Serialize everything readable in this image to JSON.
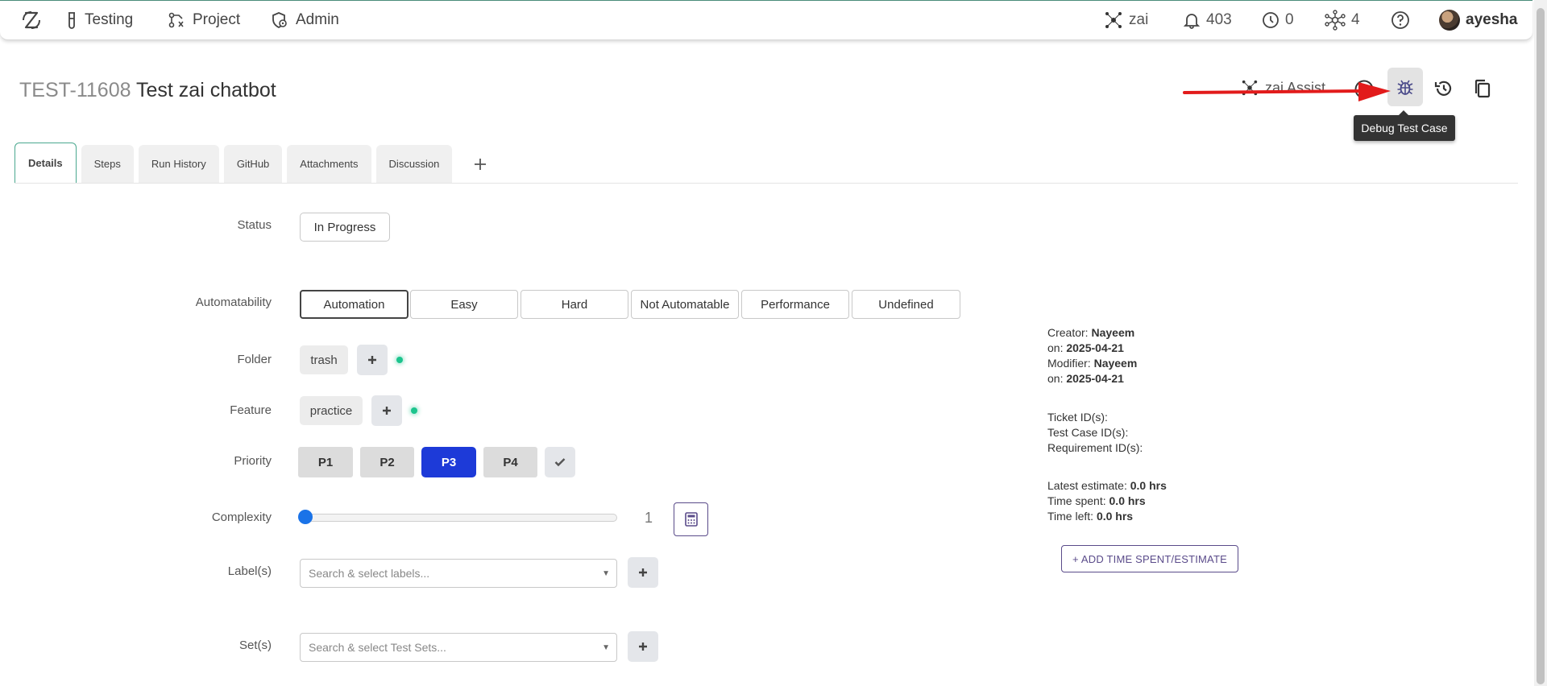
{
  "nav": {
    "items": [
      {
        "label": "Testing",
        "icon": "flask-icon"
      },
      {
        "label": "Project",
        "icon": "project-icon"
      },
      {
        "label": "Admin",
        "icon": "admin-icon"
      }
    ],
    "zai_label": "zai",
    "notifications_count": "403",
    "timer_count": "0",
    "network_count": "4",
    "username": "ayesha"
  },
  "header": {
    "test_key": "TEST-11608",
    "test_title": "Test zai chatbot",
    "zai_assist_label": "zai Assist",
    "tooltip": "Debug Test Case"
  },
  "tabs": [
    "Details",
    "Steps",
    "Run History",
    "GitHub",
    "Attachments",
    "Discussion"
  ],
  "form": {
    "status_label": "Status",
    "status_value": "In Progress",
    "automatability_label": "Automatability",
    "automatability_options": [
      "Automation",
      "Easy",
      "Hard",
      "Not Automatable",
      "Performance",
      "Undefined"
    ],
    "automatability_selected": "Automation",
    "folder_label": "Folder",
    "folder_value": "trash",
    "feature_label": "Feature",
    "feature_value": "practice",
    "priority_label": "Priority",
    "priority_options": [
      "P1",
      "P2",
      "P3",
      "P4"
    ],
    "priority_selected": "P3",
    "complexity_label": "Complexity",
    "complexity_value": "1",
    "labels_label": "Label(s)",
    "labels_placeholder": "Search & select labels...",
    "sets_label": "Set(s)",
    "sets_placeholder": "Search & select Test Sets..."
  },
  "info": {
    "creator_label": "Creator:",
    "creator_name": "Nayeem",
    "on_label": "on:",
    "created_on": "2025-04-21",
    "modifier_label": "Modifier:",
    "modifier_name": "Nayeem",
    "modified_on": "2025-04-21",
    "ticket_ids_label": "Ticket ID(s):",
    "test_case_ids_label": "Test Case ID(s):",
    "requirement_ids_label": "Requirement ID(s):",
    "latest_estimate_label": "Latest estimate:",
    "latest_estimate_value": "0.0 hrs",
    "time_spent_label": "Time spent:",
    "time_spent_value": "0.0 hrs",
    "time_left_label": "Time left:",
    "time_left_value": "0.0 hrs",
    "add_time_button": "+ ADD TIME SPENT/ESTIMATE"
  },
  "colors": {
    "accent_teal": "#4aa88f",
    "priority_active": "#1d3ad8",
    "slider": "#1a73e8",
    "arrow": "#e21b1b",
    "status_dot": "#1cc48d"
  }
}
